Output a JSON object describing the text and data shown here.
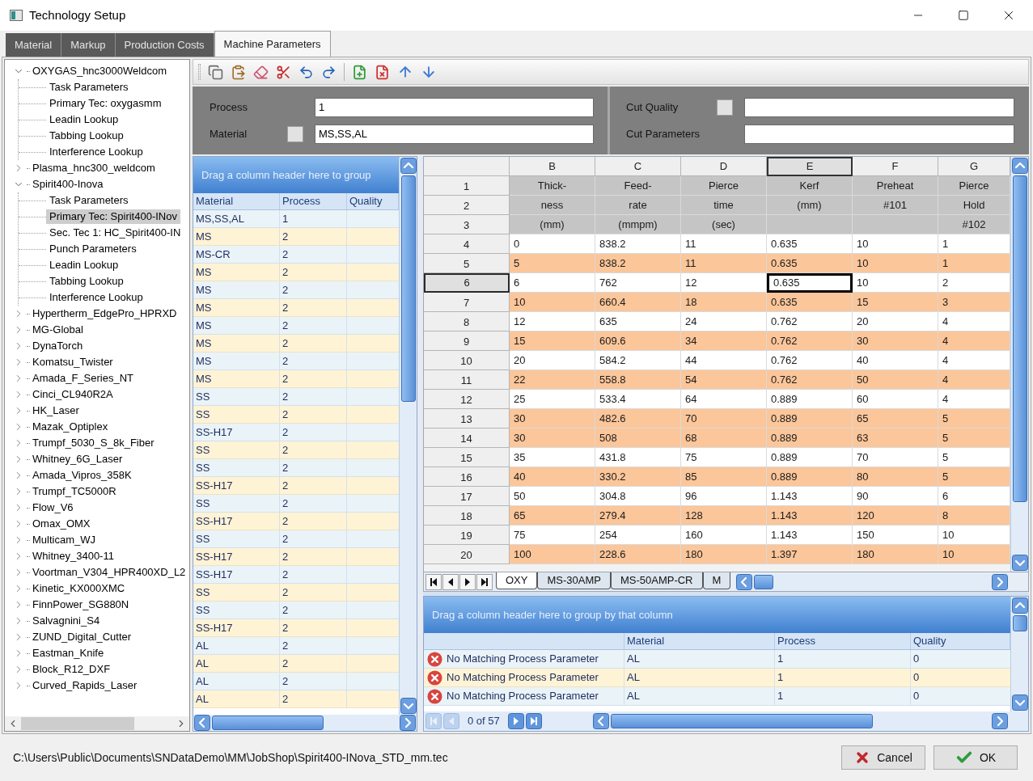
{
  "window": {
    "title": "Technology Setup"
  },
  "tabs": [
    {
      "label": "Material",
      "selected": false
    },
    {
      "label": "Markup",
      "selected": false
    },
    {
      "label": "Production Costs",
      "selected": false
    },
    {
      "label": "Machine Parameters",
      "selected": true
    }
  ],
  "tree": [
    {
      "label": "OXYGAS_hnc3000Weldcom",
      "expanded": true,
      "selected": false,
      "children": [
        {
          "label": "Task Parameters",
          "selected": false
        },
        {
          "label": "Primary Tec: oxygasmm",
          "selected": false
        },
        {
          "label": "Leadin Lookup",
          "selected": false
        },
        {
          "label": "Tabbing Lookup",
          "selected": false
        },
        {
          "label": "Interference Lookup",
          "selected": false
        }
      ]
    },
    {
      "label": "Plasma_hnc300_weldcom",
      "expanded": false,
      "selected": false
    },
    {
      "label": "Spirit400-Inova",
      "expanded": true,
      "selected": false,
      "children": [
        {
          "label": "Task Parameters",
          "selected": false
        },
        {
          "label": "Primary Tec: Spirit400-INov",
          "selected": true
        },
        {
          "label": "Sec. Tec 1: HC_Spirit400-IN",
          "selected": false
        },
        {
          "label": "Punch Parameters",
          "selected": false
        },
        {
          "label": "Leadin Lookup",
          "selected": false
        },
        {
          "label": "Tabbing Lookup",
          "selected": false
        },
        {
          "label": "Interference Lookup",
          "selected": false
        }
      ]
    },
    {
      "label": "Hypertherm_EdgePro_HPRXD",
      "expanded": false,
      "selected": false
    },
    {
      "label": "MG-Global",
      "expanded": false,
      "selected": false
    },
    {
      "label": "DynaTorch",
      "expanded": false,
      "selected": false
    },
    {
      "label": "Komatsu_Twister",
      "expanded": false,
      "selected": false
    },
    {
      "label": "Amada_F_Series_NT",
      "expanded": false,
      "selected": false
    },
    {
      "label": "Cinci_CL940R2A",
      "expanded": false,
      "selected": false
    },
    {
      "label": "HK_Laser",
      "expanded": false,
      "selected": false
    },
    {
      "label": "Mazak_Optiplex",
      "expanded": false,
      "selected": false
    },
    {
      "label": "Trumpf_5030_S_8k_Fiber",
      "expanded": false,
      "selected": false
    },
    {
      "label": "Whitney_6G_Laser",
      "expanded": false,
      "selected": false
    },
    {
      "label": "Amada_Vipros_358K",
      "expanded": false,
      "selected": false
    },
    {
      "label": "Trumpf_TC5000R",
      "expanded": false,
      "selected": false
    },
    {
      "label": "Flow_V6",
      "expanded": false,
      "selected": false
    },
    {
      "label": "Omax_OMX",
      "expanded": false,
      "selected": false
    },
    {
      "label": "Multicam_WJ",
      "expanded": false,
      "selected": false
    },
    {
      "label": "Whitney_3400-11",
      "expanded": false,
      "selected": false
    },
    {
      "label": "Voortman_V304_HPR400XD_L2",
      "expanded": false,
      "selected": false
    },
    {
      "label": "Kinetic_KX000XMC",
      "expanded": false,
      "selected": false
    },
    {
      "label": "FinnPower_SG880N",
      "expanded": false,
      "selected": false
    },
    {
      "label": "Salvagnini_S4",
      "expanded": false,
      "selected": false
    },
    {
      "label": "ZUND_Digital_Cutter",
      "expanded": false,
      "selected": false
    },
    {
      "label": "Eastman_Knife",
      "expanded": false,
      "selected": false
    },
    {
      "label": "Block_R12_DXF",
      "expanded": false,
      "selected": false
    },
    {
      "label": "Curved_Rapids_Laser",
      "expanded": false,
      "selected": false
    }
  ],
  "form": {
    "process": {
      "label": "Process",
      "value": "1"
    },
    "material": {
      "label": "Material",
      "value": "MS,SS,AL"
    },
    "cut_quality": {
      "label": "Cut Quality"
    },
    "cut_parameters": {
      "label": "Cut Parameters"
    }
  },
  "process_list": {
    "group_hint": "Drag a column header here to group",
    "columns": [
      "Material",
      "Process",
      "Quality"
    ],
    "rows": [
      {
        "material": "MS,SS,AL",
        "process": "1"
      },
      {
        "material": "MS",
        "process": "2"
      },
      {
        "material": "MS-CR",
        "process": "2"
      },
      {
        "material": "MS",
        "process": "2"
      },
      {
        "material": "MS",
        "process": "2"
      },
      {
        "material": "MS",
        "process": "2"
      },
      {
        "material": "MS",
        "process": "2"
      },
      {
        "material": "MS",
        "process": "2"
      },
      {
        "material": "MS",
        "process": "2"
      },
      {
        "material": "MS",
        "process": "2"
      },
      {
        "material": "SS",
        "process": "2"
      },
      {
        "material": "SS",
        "process": "2"
      },
      {
        "material": "SS-H17",
        "process": "2"
      },
      {
        "material": "SS",
        "process": "2"
      },
      {
        "material": "SS",
        "process": "2"
      },
      {
        "material": "SS-H17",
        "process": "2"
      },
      {
        "material": "SS",
        "process": "2"
      },
      {
        "material": "SS-H17",
        "process": "2"
      },
      {
        "material": "SS",
        "process": "2"
      },
      {
        "material": "SS-H17",
        "process": "2"
      },
      {
        "material": "SS-H17",
        "process": "2"
      },
      {
        "material": "SS",
        "process": "2"
      },
      {
        "material": "SS",
        "process": "2"
      },
      {
        "material": "SS-H17",
        "process": "2"
      },
      {
        "material": "AL",
        "process": "2"
      },
      {
        "material": "AL",
        "process": "2"
      },
      {
        "material": "AL",
        "process": "2"
      },
      {
        "material": "AL",
        "process": "2"
      }
    ]
  },
  "sheet": {
    "columns": [
      {
        "letter": "B",
        "selected": false
      },
      {
        "letter": "C",
        "selected": false
      },
      {
        "letter": "D",
        "selected": false
      },
      {
        "letter": "E",
        "selected": true
      },
      {
        "letter": "F",
        "selected": false
      },
      {
        "letter": "G",
        "selected": false
      }
    ],
    "rows": [
      {
        "number": "1",
        "kind": "header",
        "selected": false,
        "cells": [
          "Thick-",
          "Feed-",
          "Pierce",
          "Kerf",
          "Preheat",
          "Pierce"
        ]
      },
      {
        "number": "2",
        "kind": "header",
        "selected": false,
        "cells": [
          "ness",
          "rate",
          "time",
          "(mm)",
          "#101",
          "Hold"
        ]
      },
      {
        "number": "3",
        "kind": "header",
        "selected": false,
        "cells": [
          "(mm)",
          "(mmpm)",
          "(sec)",
          null,
          null,
          "#102"
        ]
      },
      {
        "number": "4",
        "kind": "data",
        "selected": false,
        "shaded": false,
        "cells": [
          "0",
          "838.2",
          "11",
          "0.635",
          "10",
          "1"
        ]
      },
      {
        "number": "5",
        "kind": "data",
        "selected": false,
        "shaded": true,
        "cells": [
          "5",
          "838.2",
          "11",
          "0.635",
          "10",
          "1"
        ]
      },
      {
        "number": "6",
        "kind": "data",
        "selected": true,
        "shaded": false,
        "cells": [
          "6",
          "762",
          "12",
          "0.635",
          "10",
          "2"
        ]
      },
      {
        "number": "7",
        "kind": "data",
        "selected": false,
        "shaded": true,
        "cells": [
          "10",
          "660.4",
          "18",
          "0.635",
          "15",
          "3"
        ]
      },
      {
        "number": "8",
        "kind": "data",
        "selected": false,
        "shaded": false,
        "cells": [
          "12",
          "635",
          "24",
          "0.762",
          "20",
          "4"
        ]
      },
      {
        "number": "9",
        "kind": "data",
        "selected": false,
        "shaded": true,
        "cells": [
          "15",
          "609.6",
          "34",
          "0.762",
          "30",
          "4"
        ]
      },
      {
        "number": "10",
        "kind": "data",
        "selected": false,
        "shaded": false,
        "cells": [
          "20",
          "584.2",
          "44",
          "0.762",
          "40",
          "4"
        ]
      },
      {
        "number": "11",
        "kind": "data",
        "selected": false,
        "shaded": true,
        "cells": [
          "22",
          "558.8",
          "54",
          "0.762",
          "50",
          "4"
        ]
      },
      {
        "number": "12",
        "kind": "data",
        "selected": false,
        "shaded": false,
        "cells": [
          "25",
          "533.4",
          "64",
          "0.889",
          "60",
          "4"
        ]
      },
      {
        "number": "13",
        "kind": "data",
        "selected": false,
        "shaded": true,
        "cells": [
          "30",
          "482.6",
          "70",
          "0.889",
          "65",
          "5"
        ]
      },
      {
        "number": "14",
        "kind": "data",
        "selected": false,
        "shaded": true,
        "cells": [
          "30",
          "508",
          "68",
          "0.889",
          "63",
          "5"
        ]
      },
      {
        "number": "15",
        "kind": "data",
        "selected": false,
        "shaded": false,
        "cells": [
          "35",
          "431.8",
          "75",
          "0.889",
          "70",
          "5"
        ]
      },
      {
        "number": "16",
        "kind": "data",
        "selected": false,
        "shaded": true,
        "cells": [
          "40",
          "330.2",
          "85",
          "0.889",
          "80",
          "5"
        ]
      },
      {
        "number": "17",
        "kind": "data",
        "selected": false,
        "shaded": false,
        "cells": [
          "50",
          "304.8",
          "96",
          "1.143",
          "90",
          "6"
        ]
      },
      {
        "number": "18",
        "kind": "data",
        "selected": false,
        "shaded": true,
        "cells": [
          "65",
          "279.4",
          "128",
          "1.143",
          "120",
          "8"
        ]
      },
      {
        "number": "19",
        "kind": "data",
        "selected": false,
        "shaded": false,
        "cells": [
          "75",
          "254",
          "160",
          "1.143",
          "150",
          "10"
        ]
      },
      {
        "number": "20",
        "kind": "data",
        "selected": false,
        "shaded": true,
        "cells": [
          "100",
          "228.6",
          "180",
          "1.397",
          "180",
          "10"
        ]
      }
    ],
    "tabs": [
      {
        "label": "OXY",
        "selected": true
      },
      {
        "label": "MS-30AMP",
        "selected": false
      },
      {
        "label": "MS-50AMP-CR",
        "selected": false
      },
      {
        "label": "M",
        "selected": false
      }
    ]
  },
  "messages": {
    "group_hint": "Drag a column header here to group by that column",
    "columns": [
      "Material",
      "Process",
      "Quality"
    ],
    "rows": [
      {
        "message": "No Matching Process Parameter",
        "material": "AL",
        "process": "1",
        "quality": "0"
      },
      {
        "message": "No Matching Process Parameter",
        "material": "AL",
        "process": "1",
        "quality": "0"
      },
      {
        "message": "No Matching Process Parameter",
        "material": "AL",
        "process": "1",
        "quality": "0"
      }
    ],
    "pager": {
      "text": "0 of 57",
      "buttons": [
        {
          "kind": "first",
          "disabled": true
        },
        {
          "kind": "previous",
          "disabled": true
        },
        {
          "kind": "next",
          "disabled": false
        },
        {
          "kind": "last",
          "disabled": false
        }
      ]
    }
  },
  "status_bar": {
    "path": "C:\\Users\\Public\\Documents\\SNDataDemo\\MM\\JobShop\\Spirit400-INova_STD_mm.tec"
  },
  "buttons": [
    {
      "kind": "cancel",
      "label": "Cancel"
    },
    {
      "kind": "ok",
      "label": "OK"
    }
  ]
}
